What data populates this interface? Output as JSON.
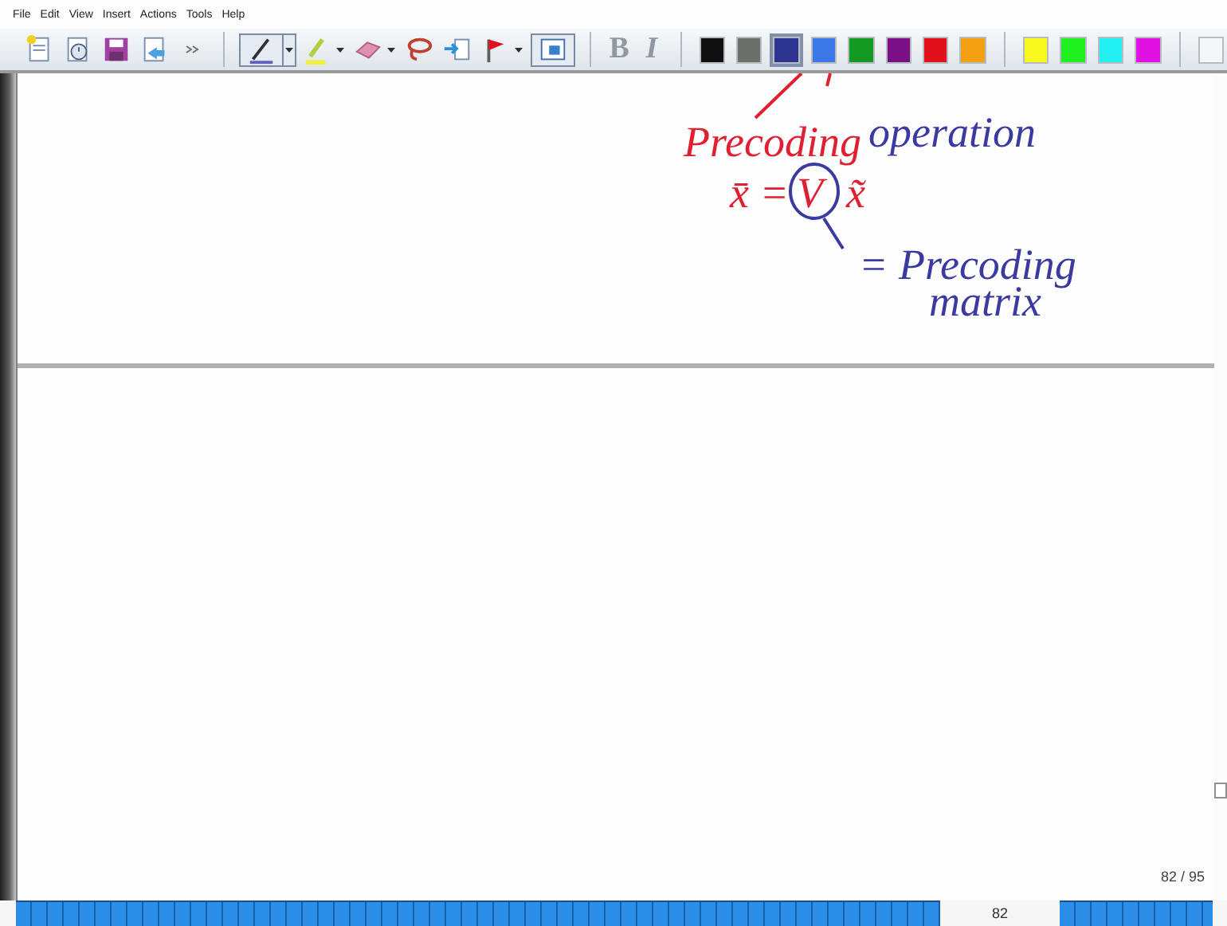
{
  "menu": [
    "File",
    "Edit",
    "View",
    "Insert",
    "Actions",
    "Tools",
    "Help"
  ],
  "toolbar": {
    "tools": [
      {
        "kind": "new-page",
        "selected": false
      },
      {
        "kind": "history",
        "selected": false
      },
      {
        "kind": "save",
        "selected": false
      },
      {
        "kind": "send",
        "selected": false
      },
      {
        "kind": "more",
        "selected": false
      },
      {
        "kind": "pen",
        "selected": true,
        "dropdown": true
      },
      {
        "kind": "highlighter",
        "selected": false,
        "dropdown": true
      },
      {
        "kind": "eraser",
        "selected": false,
        "dropdown": true
      },
      {
        "kind": "lasso",
        "selected": false
      },
      {
        "kind": "insert-space",
        "selected": false
      },
      {
        "kind": "flag",
        "selected": false,
        "dropdown": true
      },
      {
        "kind": "select-box",
        "selected": true
      }
    ],
    "format": [
      {
        "text": "B",
        "kind": "bold",
        "disabled": true
      },
      {
        "text": "I",
        "kind": "italic",
        "disabled": true
      }
    ],
    "colors": [
      {
        "color": "#101010",
        "selected": false
      },
      {
        "color": "#6c6f6a",
        "selected": false
      },
      {
        "color": "#2e3590",
        "selected": true
      },
      {
        "color": "#3c78e8",
        "selected": false
      },
      {
        "color": "#129a22",
        "selected": false
      },
      {
        "color": "#7a0f86",
        "selected": false
      },
      {
        "color": "#e0101c",
        "selected": false
      },
      {
        "color": "#f2a010",
        "selected": false
      },
      {
        "color": "#f8f81c",
        "selected": false
      },
      {
        "color": "#20f020",
        "selected": false
      },
      {
        "color": "#20f0f0",
        "selected": false
      },
      {
        "color": "#e010e0",
        "selected": false
      },
      {
        "color": "#f4f6f8",
        "selected": false
      }
    ]
  },
  "ink": [
    {
      "kind": "text",
      "text": "Precoding",
      "color": "#e02030"
    },
    {
      "kind": "text",
      "text": "operation",
      "color": "#3a3aa0"
    },
    {
      "kind": "text",
      "text": "x̄ =",
      "color": "#e02030"
    },
    {
      "kind": "text",
      "text": "V",
      "color": "#e02030"
    },
    {
      "kind": "text",
      "text": "x̃",
      "color": "#e02030"
    },
    {
      "kind": "text",
      "text": "= Precoding",
      "color": "#3a3aa0"
    },
    {
      "kind": "text",
      "text": "matrix",
      "color": "#3a3aa0"
    }
  ],
  "page_indicator": "82 / 95",
  "timeline": {
    "label": "82"
  }
}
